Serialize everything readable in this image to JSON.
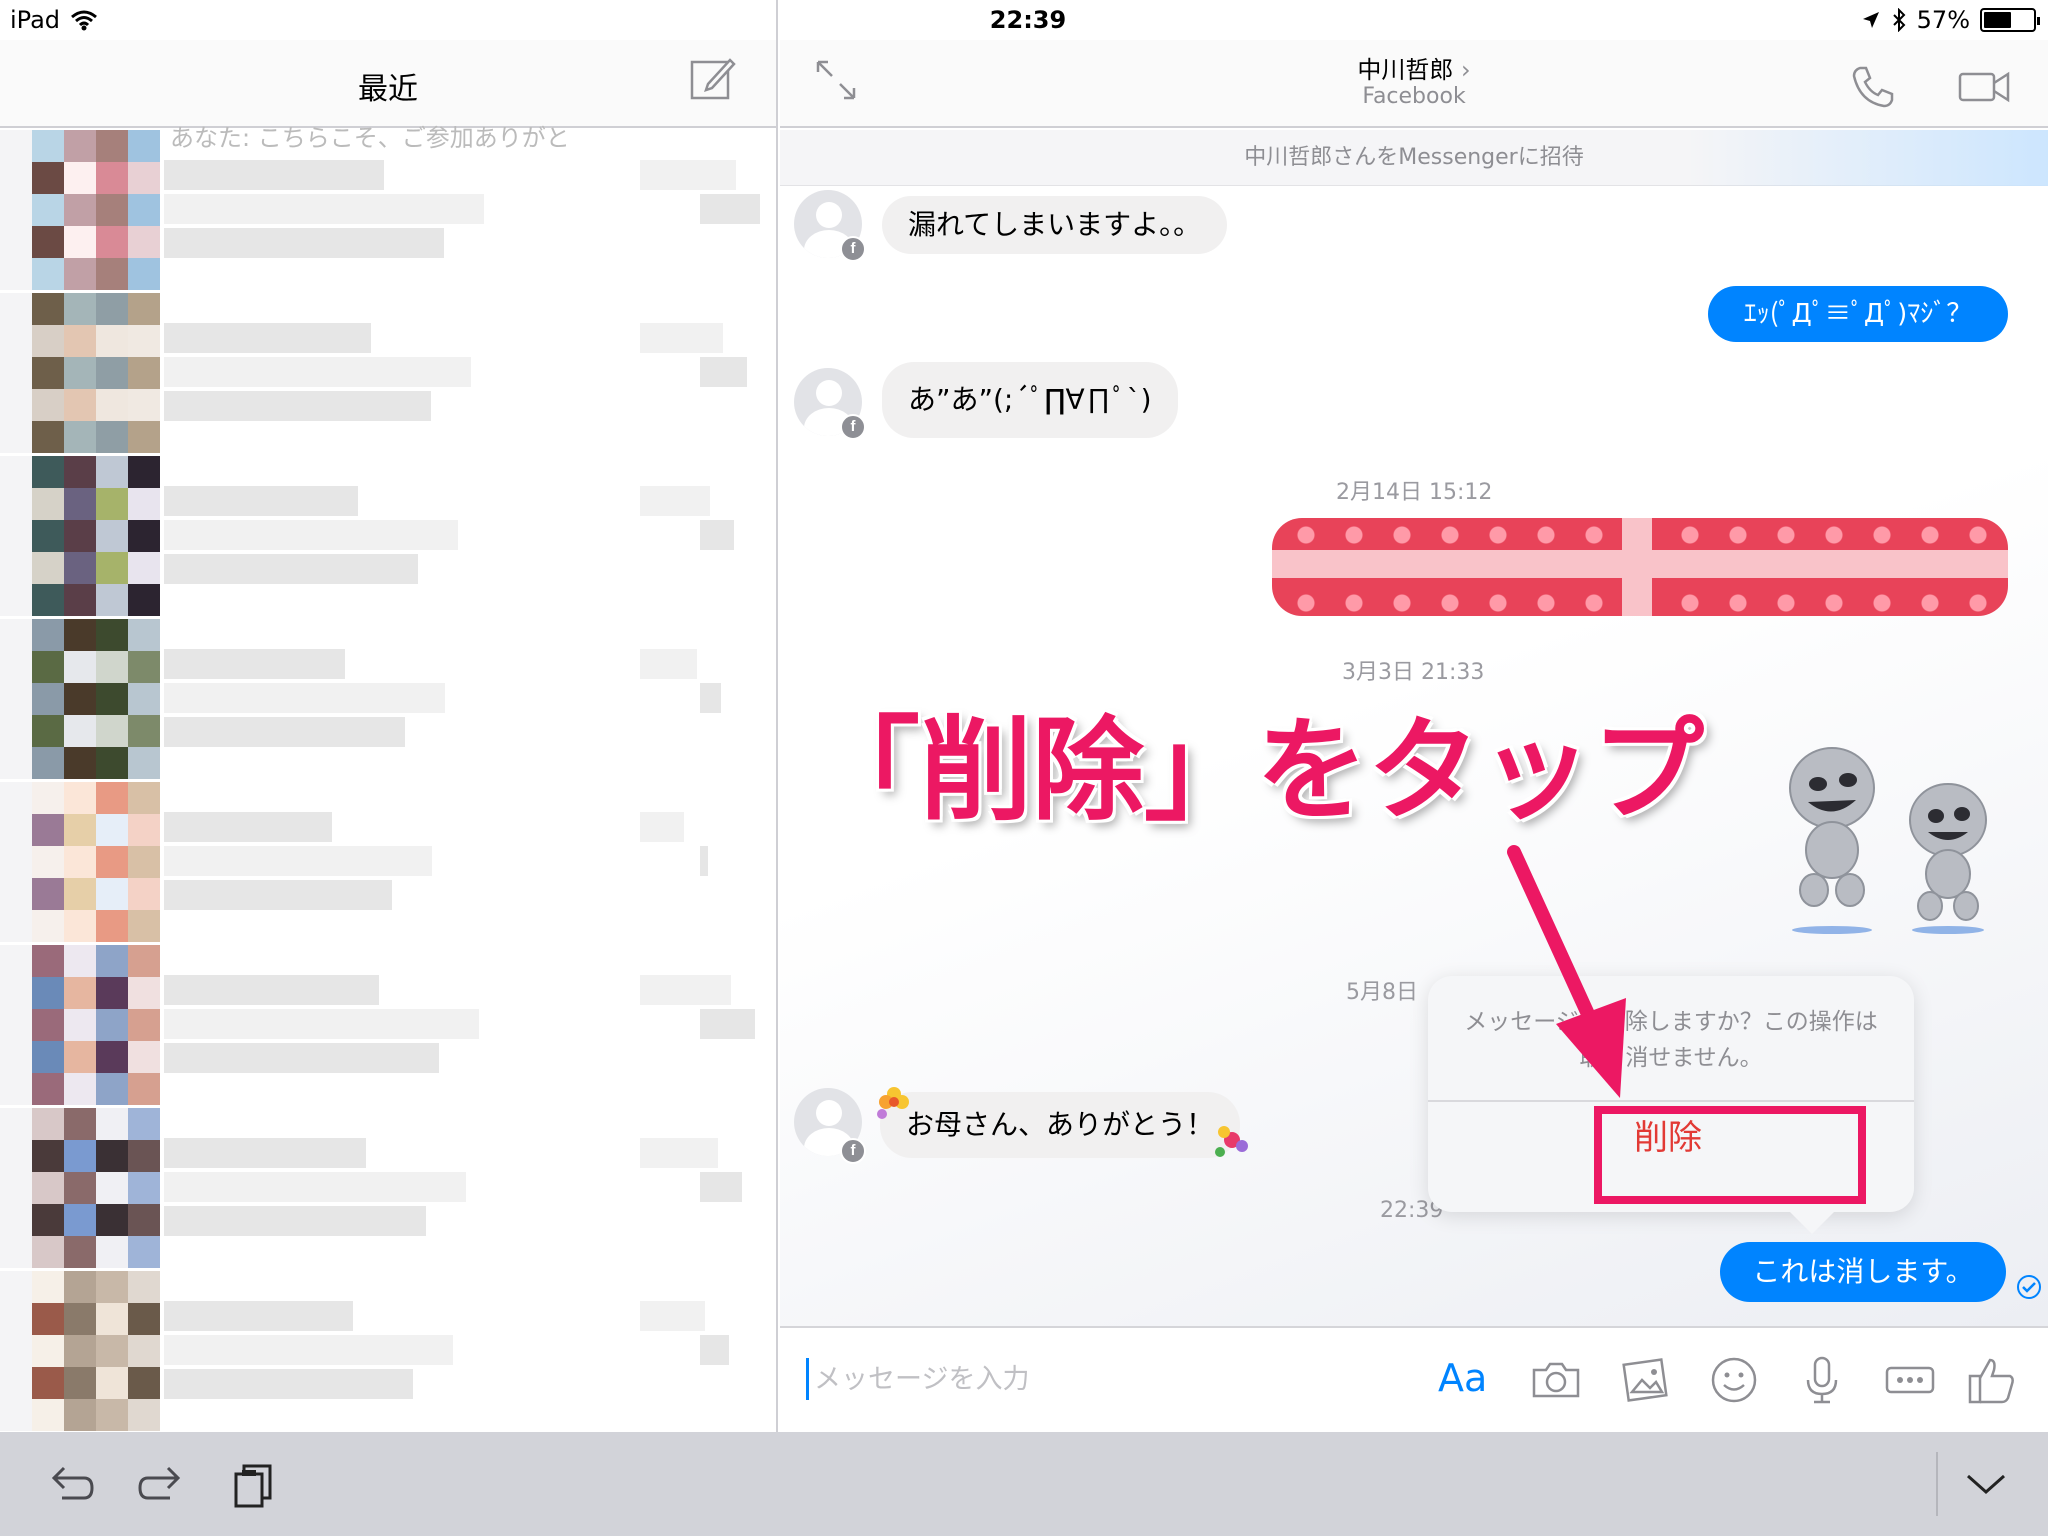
{
  "status_bar": {
    "device": "iPad",
    "time": "22:39",
    "battery": "57%",
    "battery_level": 0.57
  },
  "left_pane": {
    "title": "最近",
    "preview_partial": "あなた: こちらこそ、ご参加ありがと"
  },
  "chat_header": {
    "name": "中川哲郎",
    "subtitle": "Facebook"
  },
  "invite_bar": "中川哲郎さんをMessengerに招待",
  "messages": [
    {
      "from": "them",
      "text": "漏れてしまいますよ。。"
    },
    {
      "from": "me",
      "text": "ｴｯ(ﾟДﾟ≡ﾟДﾟ)ﾏｼﾞ？"
    },
    {
      "from": "them",
      "text": "あ”あ”(;´ﾟ∏∀∏ﾟ`)"
    },
    {
      "from": "them",
      "text": "お母さん、ありがとう！"
    },
    {
      "from": "me",
      "text": "これは消します。"
    }
  ],
  "timestamps": [
    "2月14日 15:12",
    "3月3日 21:33",
    "5月8日",
    "22:39"
  ],
  "popover": {
    "message": "メッセージを削除しますか？この操作は取り消せません。",
    "delete_label": "削除"
  },
  "annotation": {
    "caption": "「削除」をタップ",
    "color": "#ec1863"
  },
  "composer": {
    "placeholder": "メッセージを入力",
    "aa_label": "Aa"
  },
  "colors": {
    "messenger_blue": "#0084ff",
    "delete_red": "#e23a35"
  },
  "icons": [
    "wifi-icon",
    "location-icon",
    "bluetooth-icon",
    "compose-icon",
    "collapse-icon",
    "phone-icon",
    "video-icon",
    "camera-icon",
    "photo-icon",
    "emoji-icon",
    "mic-icon",
    "more-icon",
    "like-icon",
    "undo-icon",
    "redo-icon",
    "clipboard-icon",
    "keyboard-dismiss-icon",
    "sent-check-icon"
  ]
}
